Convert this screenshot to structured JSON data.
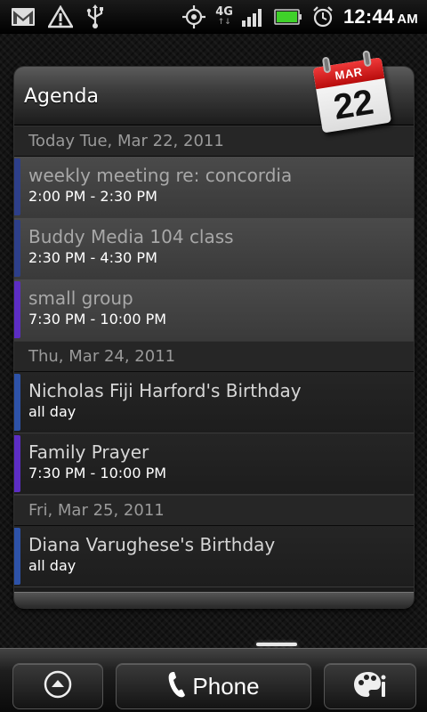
{
  "status_bar": {
    "icons_left": [
      "gmail-icon",
      "warning-icon",
      "usb-icon"
    ],
    "network_label": "4G",
    "network_arrows": "↑↓",
    "icons_right": [
      "gps-icon",
      "signal-icon",
      "battery-icon",
      "alarm-icon"
    ],
    "time": "12:44",
    "ampm": "AM"
  },
  "widget": {
    "title": "Agenda",
    "calendar_icon": {
      "month": "MAR",
      "day": "22"
    },
    "sections": [
      {
        "date": "Today Tue, Mar 22, 2011",
        "events": [
          {
            "title": "weekly meeting re: concordia",
            "time": "2:00 PM - 2:30 PM",
            "color": "#2d3f8a"
          },
          {
            "title": "Buddy Media 104 class",
            "time": "2:30 PM - 4:30 PM",
            "color": "#2d3f8a"
          },
          {
            "title": "small group",
            "time": "7:30 PM - 10:00 PM",
            "color": "#5c2dc4"
          }
        ]
      },
      {
        "date": "Thu, Mar 24, 2011",
        "events": [
          {
            "title": "Nicholas Fiji Harford's Birthday",
            "time": "all day",
            "color": "#2d52a8"
          },
          {
            "title": "Family Prayer",
            "time": "7:30 PM - 10:00 PM",
            "color": "#5c2dc4"
          }
        ]
      },
      {
        "date": "Fri, Mar 25, 2011",
        "events": [
          {
            "title": "Diana Varughese's Birthday",
            "time": "all day",
            "color": "#2d52a8"
          }
        ]
      }
    ]
  },
  "dock": {
    "left_icon": "arrow-up-icon",
    "phone_label": "Phone",
    "right_icon": "personalize-icon"
  }
}
